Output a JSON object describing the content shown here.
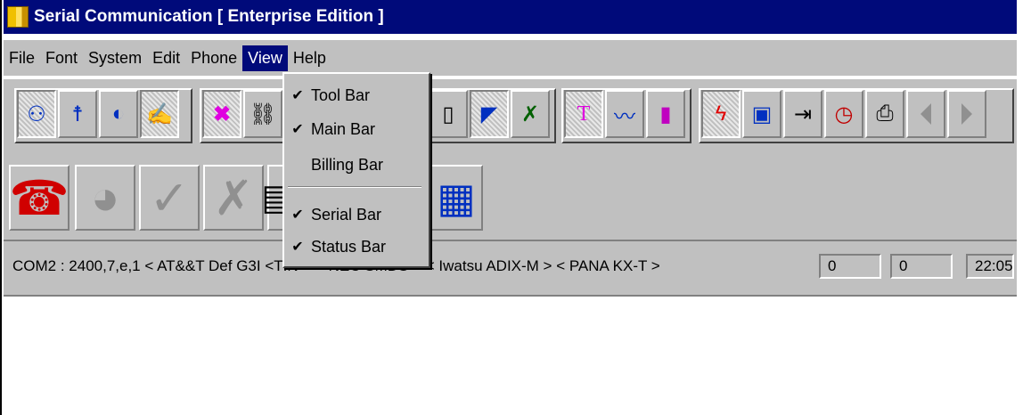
{
  "window": {
    "title": "Serial Communication [ Enterprise Edition ]"
  },
  "menubar": {
    "items": [
      {
        "label": "File"
      },
      {
        "label": "Font"
      },
      {
        "label": "System"
      },
      {
        "label": "Edit"
      },
      {
        "label": "Phone"
      },
      {
        "label": "View"
      },
      {
        "label": "Help"
      }
    ]
  },
  "view_menu": {
    "items": [
      {
        "label": "Tool Bar",
        "checked": "✔"
      },
      {
        "label": "Main Bar",
        "checked": "✔"
      },
      {
        "label": "Billing Bar",
        "checked": ""
      },
      {
        "label": "Serial Bar",
        "checked": "✔"
      },
      {
        "label": "Status Bar",
        "checked": "✔"
      }
    ]
  },
  "toolbar": {
    "icons": [
      "people-icon",
      "person-icon",
      "phone-dial-icon",
      "hand-write-icon",
      "delete-x-icon",
      "binoculars-icon",
      "cellphone-icon",
      "satellite-dish-icon",
      "tools-icon",
      "text-t-icon",
      "line-chart-icon",
      "bar-chart-icon",
      "lightning-icon",
      "save-disk-icon",
      "export-icon",
      "clock-icon",
      "printer-icon",
      "prev-arrow-icon",
      "next-arrow-icon"
    ]
  },
  "statusbar": {
    "text": "COM2 : 2400,7,e,1 < AT&&T Def G3I <TIN >   < NEC SMDS >   < Iwatsu ADIX-M >   < PANA KX-T >",
    "field1": "0",
    "field2": "0",
    "time": "22:05"
  },
  "colors": {
    "titlebar": "#000a7a",
    "face": "#c0c0c0"
  }
}
